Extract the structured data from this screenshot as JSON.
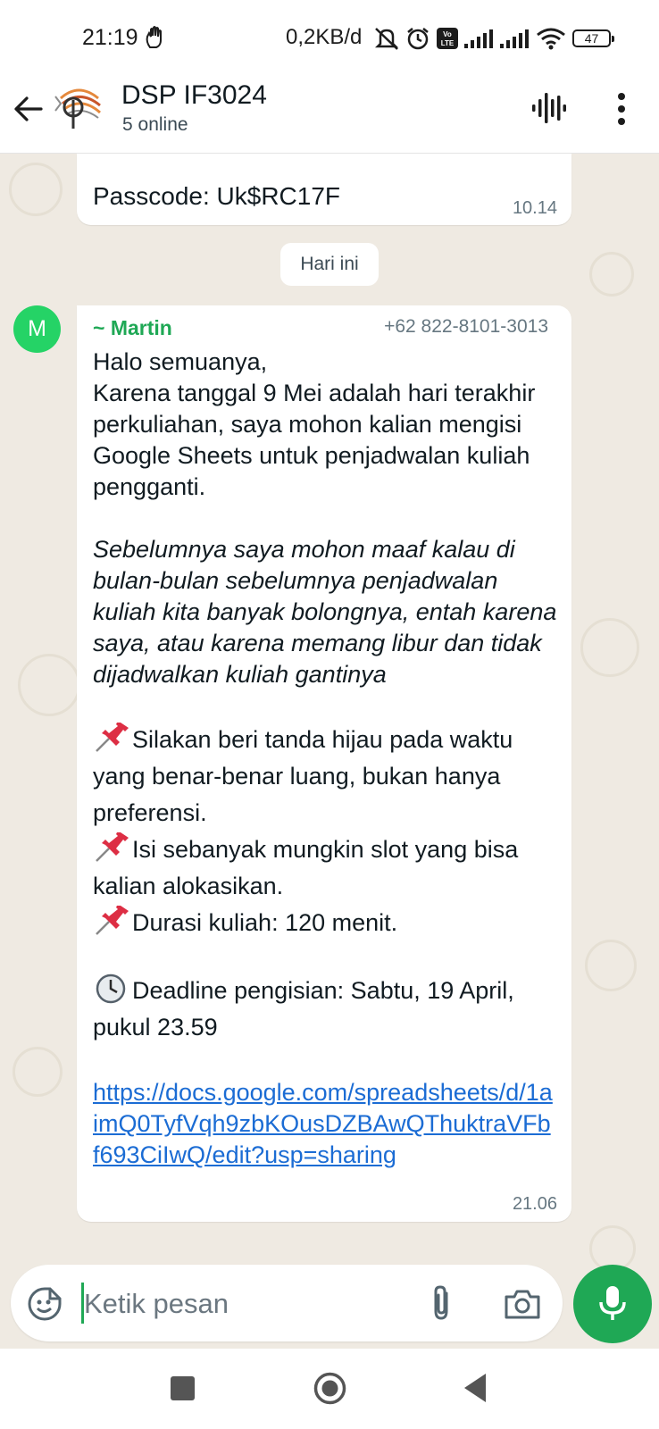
{
  "status_bar": {
    "time": "21:19",
    "network_speed": "0,2KB/d",
    "battery": "47",
    "volte_label": "Vo LTE",
    "icons": [
      "hand-icon",
      "mute-icon",
      "alarm-icon",
      "volte-icon",
      "signal-icon",
      "signal-icon",
      "wifi-icon",
      "battery-icon"
    ]
  },
  "header": {
    "title": "DSP IF3024",
    "subtitle": "5 online",
    "icons": [
      "back-arrow-icon",
      "group-avatar",
      "voice-chat-icon",
      "more-menu-icon"
    ]
  },
  "messages": {
    "prev": {
      "text": "Passcode: Uk$RC17F",
      "time": "10.14"
    },
    "date_chip": "Hari ini",
    "main": {
      "avatar_letter": "M",
      "sender": "~ Martin",
      "phone": "+62 822-8101-3013",
      "greeting": "Halo semuanya,",
      "para1": "Karena tanggal 9 Mei adalah hari terakhir perkuliahan, saya mohon kalian mengisi Google Sheets untuk penjadwalan kuliah pengganti.",
      "para2": "Sebelumnya saya mohon maaf kalau di bulan-bulan sebelumnya penjadwalan kuliah kita banyak bolongnya, entah karena saya, atau karena memang libur dan tidak dijadwalkan kuliah gantinya",
      "bullet1": "Silakan beri tanda hijau pada waktu yang benar-benar luang, bukan hanya preferensi.",
      "bullet2": "Isi sebanyak mungkin slot yang bisa kalian alokasikan.",
      "bullet3": "Durasi kuliah: 120 menit.",
      "deadline": "Deadline pengisian: Sabtu, 19 April, pukul 23.59",
      "link": "https://docs.google.com/spreadsheets/d/1aimQ0TyfVqh9zbKOusDZBAwQThuktraVFbf693CiIwQ/edit?usp=sharing",
      "time": "21.06"
    }
  },
  "input": {
    "placeholder": "Ketik pesan"
  },
  "colors": {
    "accent": "#1fa855",
    "chat_bg": "#efeae2",
    "link": "#1b6cd4"
  }
}
